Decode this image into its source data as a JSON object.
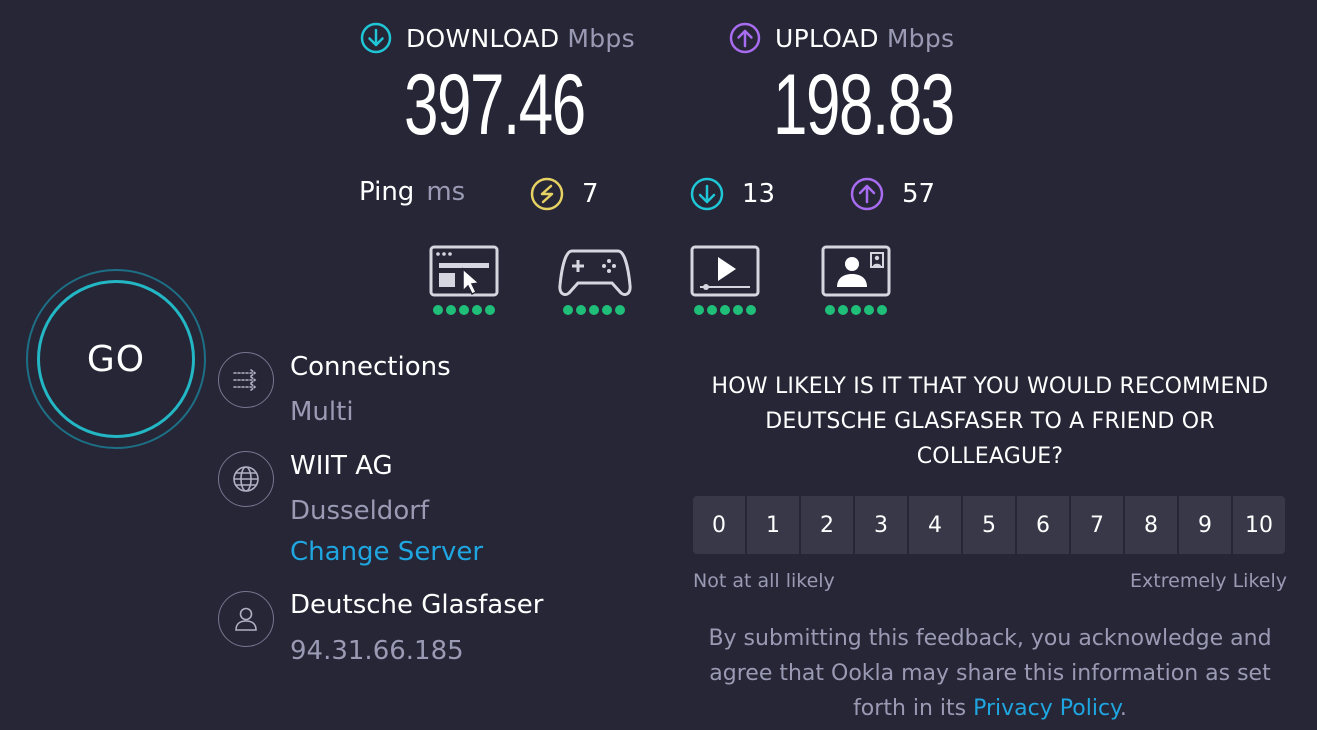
{
  "download": {
    "label": "DOWNLOAD",
    "unit": "Mbps",
    "value": "397.46",
    "color": "#1ec6d6"
  },
  "upload": {
    "label": "UPLOAD",
    "unit": "Mbps",
    "value": "198.83",
    "color": "#a86cf0"
  },
  "ping": {
    "label": "Ping",
    "unit": "ms",
    "idle": "7",
    "download": "13",
    "upload": "57",
    "idle_color": "#e6d163"
  },
  "experience": [
    {
      "icon": "web-browsing-icon",
      "rating": 5
    },
    {
      "icon": "gaming-icon",
      "rating": 5
    },
    {
      "icon": "video-streaming-icon",
      "rating": 5
    },
    {
      "icon": "video-chat-icon",
      "rating": 5
    }
  ],
  "go_button": {
    "label": "GO"
  },
  "connections": {
    "title": "Connections",
    "value": "Multi"
  },
  "server": {
    "name": "WIIT AG",
    "location": "Dusseldorf",
    "change_label": "Change Server"
  },
  "provider": {
    "name": "Deutsche Glasfaser",
    "ip": "94.31.66.185"
  },
  "survey": {
    "question": "HOW LIKELY IS IT THAT YOU WOULD RECOMMEND DEUTSCHE GLASFASER TO A FRIEND OR COLLEAGUE?",
    "scale": [
      "0",
      "1",
      "2",
      "3",
      "4",
      "5",
      "6",
      "7",
      "8",
      "9",
      "10"
    ],
    "low_label": "Not at all likely",
    "high_label": "Extremely Likely",
    "disclaimer": "By submitting this feedback, you acknowledge and agree that Ookla may share this information as set forth in its",
    "privacy_link": "Privacy Policy",
    "period": "."
  }
}
